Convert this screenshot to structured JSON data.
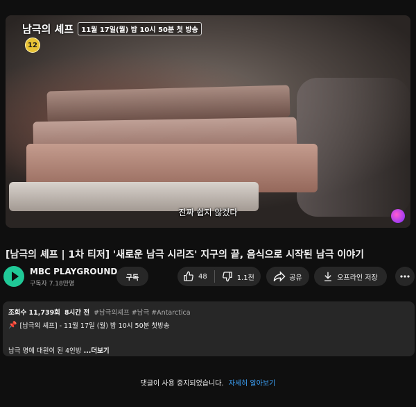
{
  "player": {
    "show_title": "남극의 셰프",
    "air_date": "11월 17일(월) 밤 10시 50분 첫 방송",
    "age_rating": "12",
    "subtitle": "진짜 쉽지 않겠다"
  },
  "video": {
    "title": "[남극의 셰프 | 1차 티저] '새로운 남극 시리즈' 지구의 끝, 음식으로 시작된 남극 이야기"
  },
  "channel": {
    "name": "MBC PLAYGROUND",
    "subscribers": "구독자 7.18만명",
    "subscribe_label": "구독"
  },
  "actions": {
    "like_count": "48",
    "dislike_count": "1.1천",
    "share_label": "공유",
    "download_label": "오프라인 저장"
  },
  "description": {
    "views": "조회수 11,739회",
    "posted": "8시간 전",
    "tags": "#남극의셰프 #남극 #Antarctica",
    "pinned_line": "[남극의 셰프] - 11월 17일 (월) 밤 10시 50분 첫방송",
    "summary": "남극 명예 대원이 된 4인방",
    "more_label": "...더보기"
  },
  "comments": {
    "disabled_text": "댓글이 사용 중지되었습니다.",
    "learn_more": "자세히 알아보기"
  },
  "colors": {
    "background": "#0f0f0f",
    "pill": "#272727",
    "link": "#3ea6ff",
    "channel_avatar": "#20c997"
  }
}
